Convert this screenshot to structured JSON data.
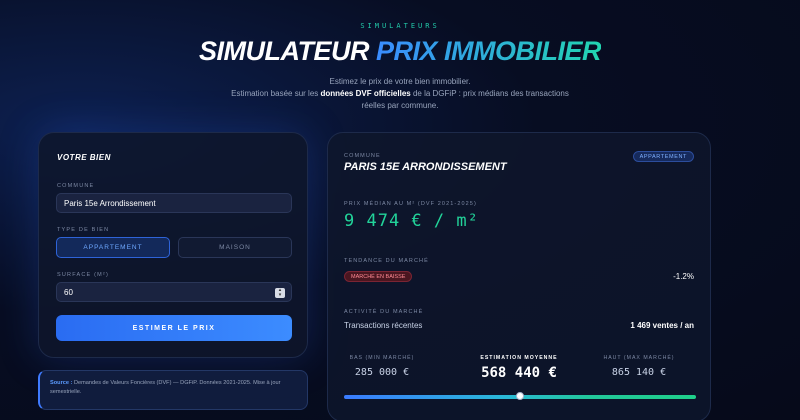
{
  "header": {
    "eyebrow": "SIMULATEURS",
    "title_part1": "SIMULATEUR",
    "title_part2": "PRIX IMMOBILIER",
    "subtitle_line1": "Estimez le prix de votre bien immobilier.",
    "subtitle_pre": "Estimation basée sur les ",
    "subtitle_bold": "données DVF officielles",
    "subtitle_post": " de la DGFiP : prix médians des transactions réelles par commune."
  },
  "form": {
    "title": "VOTRE BIEN",
    "commune_label": "COMMUNE",
    "commune_value": "Paris 15e Arrondissement",
    "type_label": "TYPE DE BIEN",
    "type_options": [
      "APPARTEMENT",
      "MAISON"
    ],
    "type_selected": "APPARTEMENT",
    "surface_label": "SURFACE (M²)",
    "surface_value": "60",
    "submit_label": "ESTIMER LE PRIX"
  },
  "source": {
    "label": "Source :",
    "text": " Demandes de Valeurs Foncières (DVF) — DGFiP. Données 2021-2025. Mise à jour semestrielle."
  },
  "result": {
    "commune_label": "COMMUNE",
    "commune_name": "PARIS 15E ARRONDISSEMENT",
    "type_badge": "APPARTEMENT",
    "price_label": "PRIX MÉDIAN AU M² (DVF 2021-2025)",
    "price_value": "9 474 € / m²",
    "trend_label": "TENDANCE DU MARCHÉ",
    "trend_badge": "MARCHÉ EN BAISSE",
    "trend_value": "-1.2%",
    "activity_label": "ACTIVITÉ DU MARCHÉ",
    "activity_text": "Transactions récentes",
    "activity_value": "1 469 ventes / an",
    "low_label": "BAS (MIN MARCHÉ)",
    "low_value": "285 000 €",
    "mid_label": "ESTIMATION MOYENNE",
    "mid_value": "568 440 €",
    "high_label": "HAUT (MAX MARCHÉ)",
    "high_value": "865 140 €",
    "range_position": 0.5
  },
  "colors": {
    "accent_blue": "#3a8cff",
    "accent_green": "#22d49a",
    "danger": "#ff8a94"
  }
}
